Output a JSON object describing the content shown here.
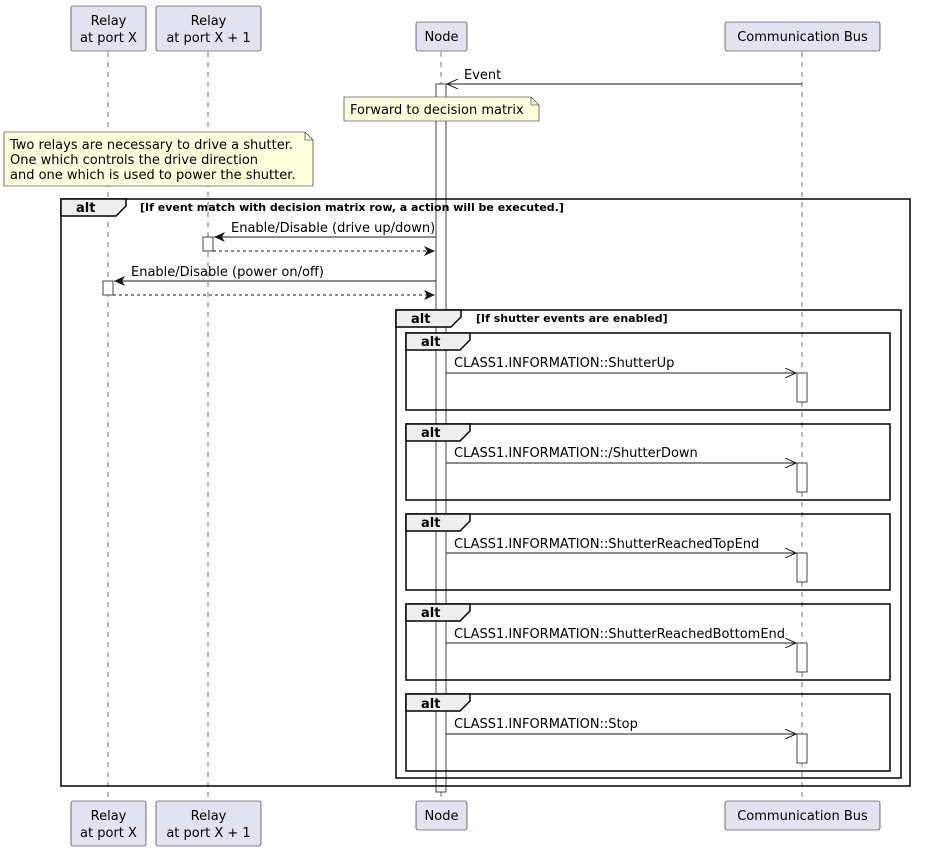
{
  "participants": [
    {
      "line1": "Relay",
      "line2": "at port X"
    },
    {
      "line1": "Relay",
      "line2": "at port X + 1"
    },
    {
      "line1": "Node",
      "line2": ""
    },
    {
      "line1": "Communication Bus",
      "line2": ""
    }
  ],
  "messages": {
    "event": "Event",
    "drive": "Enable/Disable (drive up/down)",
    "power": "Enable/Disable (power on/off)"
  },
  "notes": {
    "forward": "Forward to decision matrix",
    "relays": [
      "Two relays are necessary to drive a shutter.",
      "One which controls the drive direction",
      "and one which is used to power the shutter."
    ]
  },
  "frames": {
    "outer": {
      "keyword": "alt",
      "condition": "[If event match with decision matrix row, a action will be executed.]"
    },
    "inner": {
      "keyword": "alt",
      "condition": "[If shutter events are enabled]"
    },
    "sub": [
      {
        "keyword": "alt",
        "message": "CLASS1.INFORMATION::ShutterUp"
      },
      {
        "keyword": "alt",
        "message": "CLASS1.INFORMATION::/ShutterDown"
      },
      {
        "keyword": "alt",
        "message": "CLASS1.INFORMATION::ShutterReachedTopEnd"
      },
      {
        "keyword": "alt",
        "message": "CLASS1.INFORMATION::ShutterReachedBottomEnd"
      },
      {
        "keyword": "alt",
        "message": "CLASS1.INFORMATION::Stop"
      }
    ]
  }
}
